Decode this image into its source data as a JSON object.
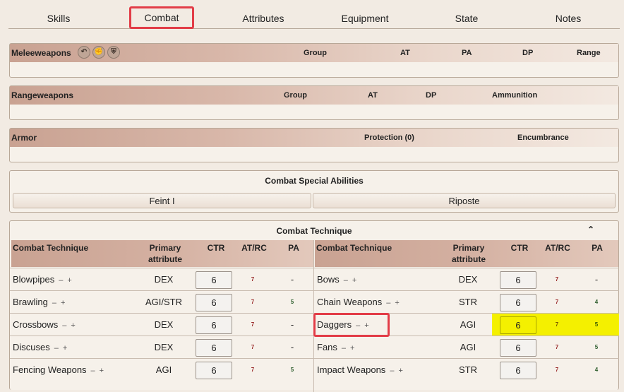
{
  "tabs": [
    "Skills",
    "Combat",
    "Attributes",
    "Equipment",
    "State",
    "Notes"
  ],
  "melee": {
    "title": "Meleeweapons",
    "columns": [
      "Group",
      "AT",
      "PA",
      "DP",
      "Range"
    ],
    "icons": [
      "undo-icon",
      "fist-icon",
      "shield-icon"
    ]
  },
  "range": {
    "title": "Rangeweapons",
    "columns": [
      "Group",
      "AT",
      "DP",
      "Ammunition"
    ]
  },
  "armor": {
    "title": "Armor",
    "columns": [
      "Protection (0)",
      "Encumbrance"
    ]
  },
  "special": {
    "title": "Combat Special Abilities",
    "items": [
      "Feint I",
      "Riposte"
    ]
  },
  "technique": {
    "title": "Combat Technique",
    "headers": {
      "name": "Combat Technique",
      "primary": "Primary attribute",
      "ctr": "CTR",
      "atrc": "AT/RC",
      "pa": "PA"
    },
    "left_rows": [
      {
        "name": "Blowpipes",
        "attr": "DEX",
        "ctr": "6",
        "at": "7",
        "pa": "-"
      },
      {
        "name": "Brawling",
        "attr": "AGI/STR",
        "ctr": "6",
        "at": "7",
        "pa": "5"
      },
      {
        "name": "Crossbows",
        "attr": "DEX",
        "ctr": "6",
        "at": "7",
        "pa": "-"
      },
      {
        "name": "Discuses",
        "attr": "DEX",
        "ctr": "6",
        "at": "7",
        "pa": "-"
      },
      {
        "name": "Fencing Weapons",
        "attr": "AGI",
        "ctr": "6",
        "at": "7",
        "pa": "5"
      }
    ],
    "right_rows": [
      {
        "name": "Bows",
        "attr": "DEX",
        "ctr": "6",
        "at": "7",
        "pa": "-"
      },
      {
        "name": "Chain Weapons",
        "attr": "STR",
        "ctr": "6",
        "at": "7",
        "pa": "4"
      },
      {
        "name": "Daggers",
        "attr": "AGI",
        "ctr": "6",
        "at": "7",
        "pa": "5"
      },
      {
        "name": "Fans",
        "attr": "AGI",
        "ctr": "6",
        "at": "7",
        "pa": "5"
      },
      {
        "name": "Impact Weapons",
        "attr": "STR",
        "ctr": "6",
        "at": "7",
        "pa": "4"
      }
    ],
    "minus": "–",
    "plus": "+"
  },
  "colors": {
    "highlight": "#f4f000",
    "annotation_red": "#e23c47",
    "header_brown": "#c9a292"
  }
}
